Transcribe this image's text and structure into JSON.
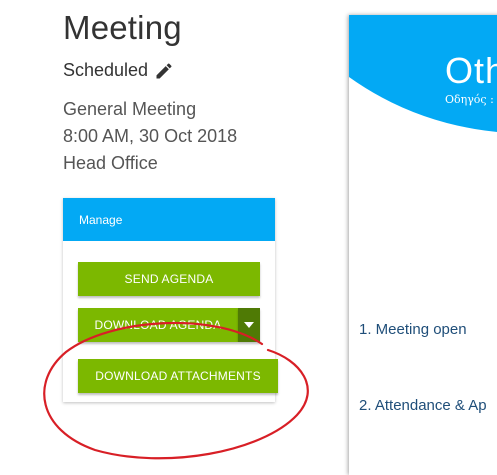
{
  "page": {
    "title": "Meeting",
    "status": "Scheduled",
    "meeting_type": "General Meeting",
    "datetime": "8:00 AM, 30 Oct 2018",
    "location": "Head Office"
  },
  "manage": {
    "header": "Manage",
    "send_agenda": "SEND AGENDA",
    "download_agenda": "DOWNLOAD AGENDA",
    "download_attachments": "DOWNLOAD ATTACHMENTS"
  },
  "document": {
    "banner_title": "Oth",
    "banner_subtitle": "Οδηγός :",
    "items": [
      "1. Meeting open",
      "2. Attendance & Ap"
    ]
  },
  "colors": {
    "header_blue": "#03a9f4",
    "button_green": "#7cb800",
    "dropdown_green": "#4f7a05",
    "annotation_red": "#d81f26"
  },
  "icons": {
    "edit": "pencil-icon",
    "dropdown": "caret-down-icon"
  }
}
